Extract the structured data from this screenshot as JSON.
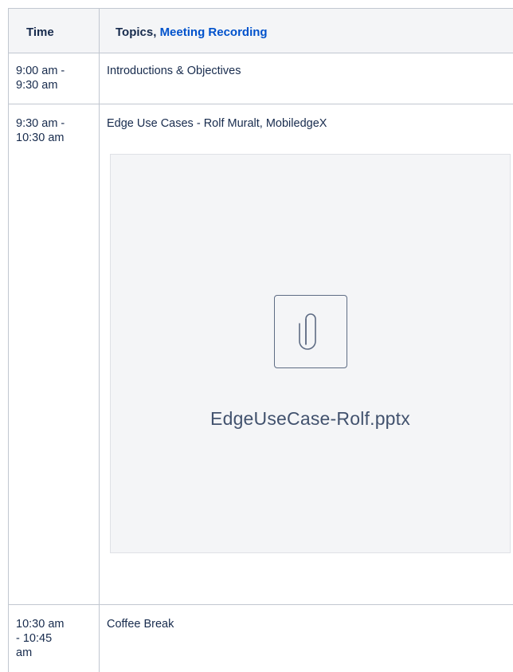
{
  "header": {
    "time_label": "Time",
    "topics_label": "Topics, ",
    "recording_link": "Meeting Recording"
  },
  "rows": [
    {
      "time_line1": "9:00 am -",
      "time_line2": "9:30 am",
      "topic": "Introductions & Objectives"
    },
    {
      "time_line1": "9:30 am -",
      "time_line2": "10:30 am",
      "topic": "Edge Use Cases - Rolf Muralt, MobiledgeX",
      "attachment": {
        "filename": "EdgeUseCase-Rolf.pptx",
        "icon": "paperclip-icon"
      }
    },
    {
      "time_line1": "10:30 am",
      "time_line2": "- 10:45",
      "time_line3": "am",
      "topic": "Coffee Break"
    }
  ]
}
